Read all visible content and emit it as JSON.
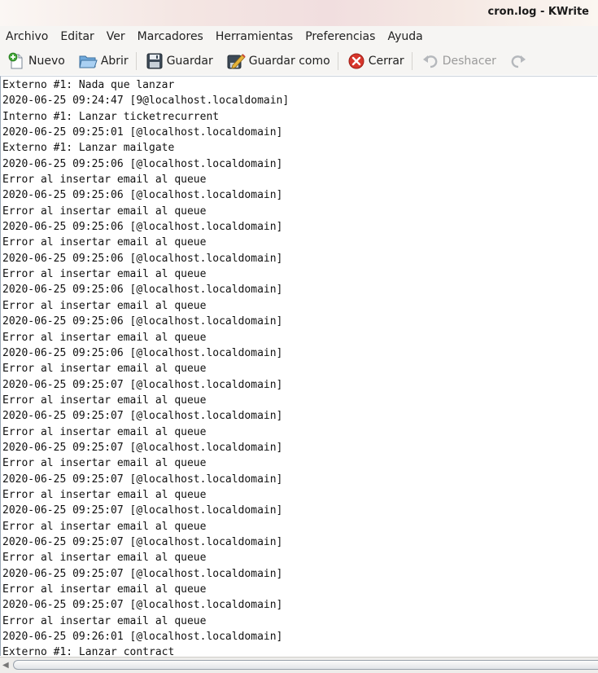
{
  "window": {
    "title": "cron.log - KWrite"
  },
  "menubar": {
    "items": [
      "Archivo",
      "Editar",
      "Ver",
      "Marcadores",
      "Herramientas",
      "Preferencias",
      "Ayuda"
    ]
  },
  "toolbar": {
    "new_label": "Nuevo",
    "open_label": "Abrir",
    "save_label": "Guardar",
    "save_as_label": "Guardar como",
    "close_label": "Cerrar",
    "undo_label": "Deshacer"
  },
  "editor": {
    "lines": [
      "Externo #1: Nada que lanzar",
      "2020-06-25 09:24:47 [9@localhost.localdomain]",
      "Interno #1: Lanzar ticketrecurrent",
      "2020-06-25 09:25:01 [@localhost.localdomain]",
      "Externo #1: Lanzar mailgate",
      "2020-06-25 09:25:06 [@localhost.localdomain]",
      "Error al insertar email al queue",
      "2020-06-25 09:25:06 [@localhost.localdomain]",
      "Error al insertar email al queue",
      "2020-06-25 09:25:06 [@localhost.localdomain]",
      "Error al insertar email al queue",
      "2020-06-25 09:25:06 [@localhost.localdomain]",
      "Error al insertar email al queue",
      "2020-06-25 09:25:06 [@localhost.localdomain]",
      "Error al insertar email al queue",
      "2020-06-25 09:25:06 [@localhost.localdomain]",
      "Error al insertar email al queue",
      "2020-06-25 09:25:06 [@localhost.localdomain]",
      "Error al insertar email al queue",
      "2020-06-25 09:25:07 [@localhost.localdomain]",
      "Error al insertar email al queue",
      "2020-06-25 09:25:07 [@localhost.localdomain]",
      "Error al insertar email al queue",
      "2020-06-25 09:25:07 [@localhost.localdomain]",
      "Error al insertar email al queue",
      "2020-06-25 09:25:07 [@localhost.localdomain]",
      "Error al insertar email al queue",
      "2020-06-25 09:25:07 [@localhost.localdomain]",
      "Error al insertar email al queue",
      "2020-06-25 09:25:07 [@localhost.localdomain]",
      "Error al insertar email al queue",
      "2020-06-25 09:25:07 [@localhost.localdomain]",
      "Error al insertar email al queue",
      "2020-06-25 09:25:07 [@localhost.localdomain]",
      "Error al insertar email al queue",
      "2020-06-25 09:26:01 [@localhost.localdomain]",
      "Externo #1: Lanzar contract"
    ]
  },
  "icons": {
    "new": "new-document-icon",
    "open": "open-folder-icon",
    "save": "floppy-disk-icon",
    "save_as": "save-as-pencil-icon",
    "close": "close-red-circle-icon",
    "undo": "undo-arrow-icon",
    "redo": "redo-arrow-icon"
  }
}
